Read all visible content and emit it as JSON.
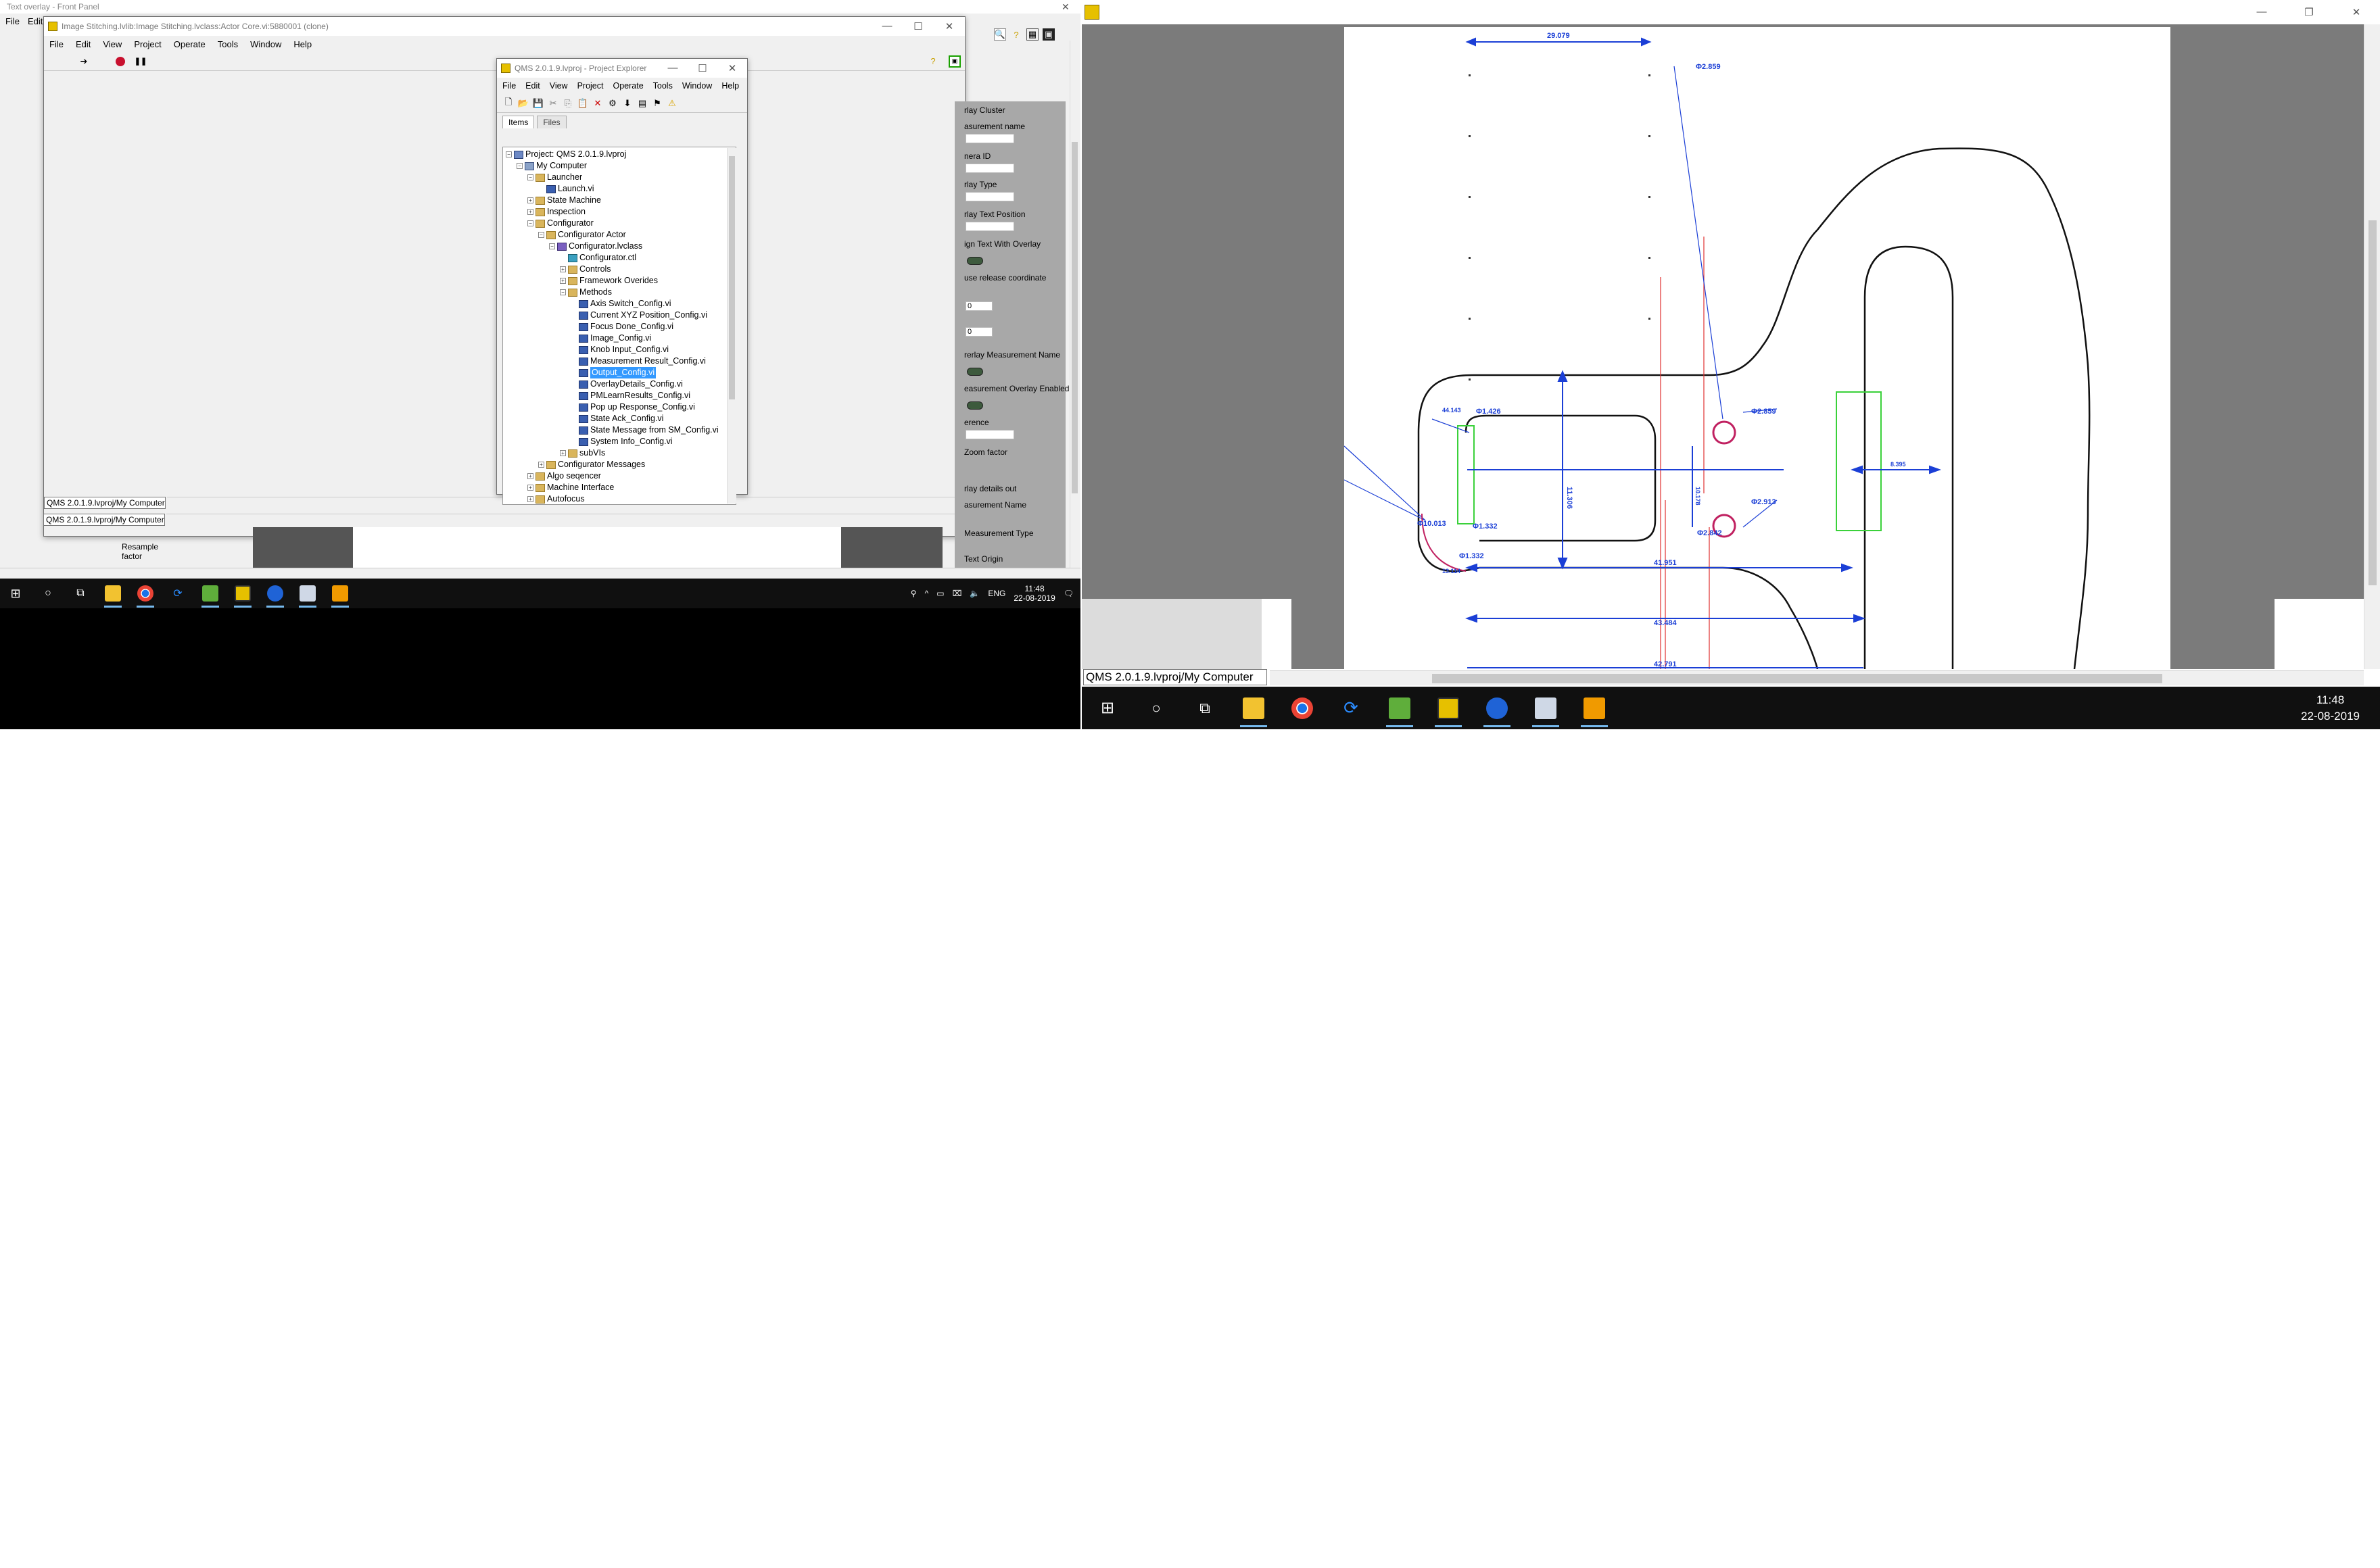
{
  "left_monitor": {
    "background_window": {
      "title_partial": "Text overlay - Front Panel",
      "menu": [
        "File",
        "Edit"
      ]
    },
    "front_panel_window": {
      "title": "Image Stitching.lvlib:Image Stitching.lvclass:Actor Core.vi:5880001 (clone)",
      "menu": [
        "File",
        "Edit",
        "View",
        "Project",
        "Operate",
        "Tools",
        "Window",
        "Help"
      ],
      "status_path_1": "QMS 2.0.1.9.lvproj/My Computer",
      "status_path_2": "QMS 2.0.1.9.lvproj/My Computer"
    },
    "project_explorer": {
      "title": "QMS 2.0.1.9.lvproj - Project Explorer",
      "menu": [
        "File",
        "Edit",
        "View",
        "Project",
        "Operate",
        "Tools",
        "Window",
        "Help"
      ],
      "tabs": [
        "Items",
        "Files"
      ],
      "tree": [
        {
          "label": "Project: QMS 2.0.1.9.lvproj",
          "icon": "project-icon",
          "level": 0,
          "exp": "-"
        },
        {
          "label": "My Computer",
          "icon": "computer-icon",
          "level": 1,
          "exp": "-"
        },
        {
          "label": "Launcher",
          "icon": "folder-icon",
          "level": 2,
          "exp": "-"
        },
        {
          "label": "Launch.vi",
          "icon": "vi-icon",
          "level": 3,
          "exp": ""
        },
        {
          "label": "State Machine",
          "icon": "folder-icon",
          "level": 2,
          "exp": "+"
        },
        {
          "label": "Inspection",
          "icon": "folder-icon",
          "level": 2,
          "exp": "+"
        },
        {
          "label": "Configurator",
          "icon": "folder-icon",
          "level": 2,
          "exp": "-"
        },
        {
          "label": "Configurator Actor",
          "icon": "folder-icon",
          "level": 3,
          "exp": "-"
        },
        {
          "label": "Configurator.lvclass",
          "icon": "class-icon",
          "level": 4,
          "exp": "-"
        },
        {
          "label": "Configurator.ctl",
          "icon": "ctl-icon",
          "level": 5,
          "exp": ""
        },
        {
          "label": "Controls",
          "icon": "folder-icon",
          "level": 5,
          "exp": "+"
        },
        {
          "label": "Framework Overides",
          "icon": "folder-icon",
          "level": 5,
          "exp": "+"
        },
        {
          "label": "Methods",
          "icon": "folder-icon",
          "level": 5,
          "exp": "-"
        },
        {
          "label": "Axis Switch_Config.vi",
          "icon": "vi-icon",
          "level": 6,
          "exp": ""
        },
        {
          "label": "Current XYZ Position_Config.vi",
          "icon": "vi-icon",
          "level": 6,
          "exp": ""
        },
        {
          "label": "Focus Done_Config.vi",
          "icon": "vi-icon",
          "level": 6,
          "exp": ""
        },
        {
          "label": "Image_Config.vi",
          "icon": "vi-icon",
          "level": 6,
          "exp": ""
        },
        {
          "label": "Knob Input_Config.vi",
          "icon": "vi-icon",
          "level": 6,
          "exp": ""
        },
        {
          "label": "Measurement Result_Config.vi",
          "icon": "vi-icon",
          "level": 6,
          "exp": ""
        },
        {
          "label": "Output_Config.vi",
          "icon": "vi-icon",
          "level": 6,
          "exp": "",
          "selected": true
        },
        {
          "label": "OverlayDetails_Config.vi",
          "icon": "vi-icon",
          "level": 6,
          "exp": ""
        },
        {
          "label": "PMLearnResults_Config.vi",
          "icon": "vi-icon",
          "level": 6,
          "exp": ""
        },
        {
          "label": "Pop up Response_Config.vi",
          "icon": "vi-icon",
          "level": 6,
          "exp": ""
        },
        {
          "label": "State Ack_Config.vi",
          "icon": "vi-icon",
          "level": 6,
          "exp": ""
        },
        {
          "label": "State Message from SM_Config.vi",
          "icon": "vi-icon",
          "level": 6,
          "exp": ""
        },
        {
          "label": "System Info_Config.vi",
          "icon": "vi-icon",
          "level": 6,
          "exp": ""
        },
        {
          "label": "subVIs",
          "icon": "folder-icon",
          "level": 5,
          "exp": "+"
        },
        {
          "label": "Configurator Messages",
          "icon": "folder-icon",
          "level": 3,
          "exp": "+"
        },
        {
          "label": "Algo seqencer",
          "icon": "folder-icon",
          "level": 2,
          "exp": "+"
        },
        {
          "label": "Machine Interface",
          "icon": "folder-icon",
          "level": 2,
          "exp": "+"
        },
        {
          "label": "Autofocus",
          "icon": "folder-icon",
          "level": 2,
          "exp": "+"
        }
      ]
    },
    "right_panel": {
      "labels": [
        "rlay Cluster",
        "asurement name",
        "nera ID",
        "rlay Type",
        "rlay Text Position",
        "ign Text With Overlay",
        "use release coordinate",
        "rerlay Measurement Name",
        "easurement Overlay Enabled",
        "erence",
        "Zoom factor",
        "rlay details out",
        "asurement Name",
        "Measurement Type",
        "Text Origin"
      ],
      "numeric_values": [
        "0",
        "0"
      ]
    },
    "resample_label": "Resample factor",
    "taskbar": {
      "time": "11:48",
      "date": "22-08-2019",
      "lang": "ENG"
    }
  },
  "right_monitor": {
    "window": {
      "status_path": "QMS 2.0.1.9.lvproj/My Computer"
    },
    "drawing_annotations": {
      "top_dim": "29.079",
      "phi_top": "Φ2.859",
      "phi_right1": "Φ2.859",
      "phi_right2": "Φ2.913",
      "phi_left1": "Φ1.426",
      "phi_left2": "Φ10.013",
      "phi_left3": "Φ1.332",
      "phi_left4": "Φ1.332",
      "small_left": "44.143",
      "small_left2": "13.114",
      "vertical_dim": "11.306",
      "vertical_dim2": "10.178",
      "phi_mid": "Φ2.842",
      "right_dim": "8.395",
      "horiz1": "41.951",
      "horiz2": "43.484",
      "horiz3": "42.791"
    },
    "taskbar": {
      "time": "11:48",
      "date": "22-08-2019"
    }
  },
  "colors": {
    "annotation_blue": "#1b3fd6",
    "taskbar": "#101010",
    "selection": "#3399ff"
  }
}
